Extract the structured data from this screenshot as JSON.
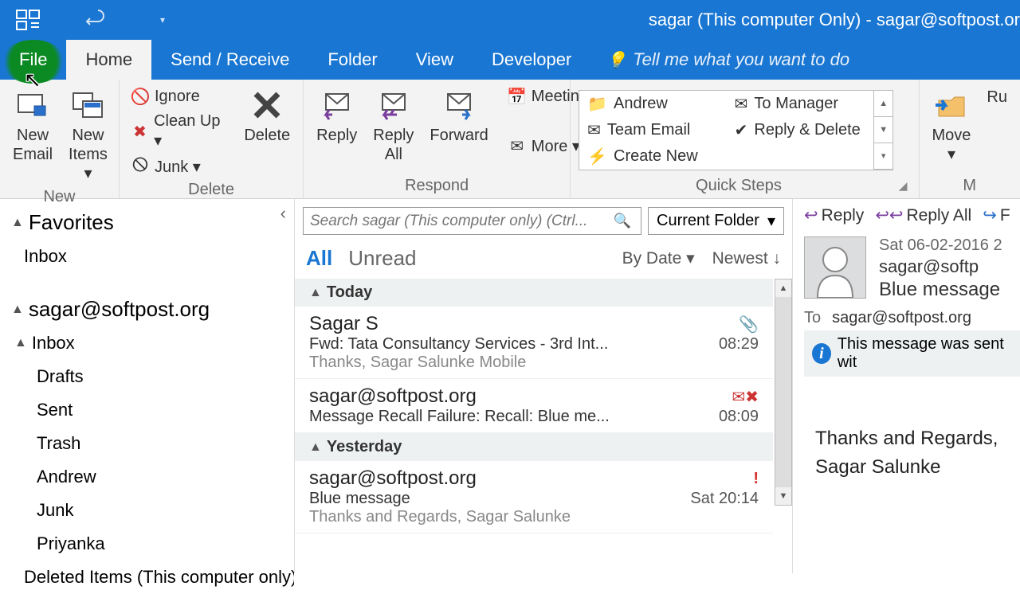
{
  "title": "sagar (This computer Only) - sagar@softpost.or",
  "tabs": {
    "file": "File",
    "home": "Home",
    "sendreceive": "Send / Receive",
    "folder": "Folder",
    "view": "View",
    "developer": "Developer",
    "tellme": "Tell me what you want to do"
  },
  "ribbon": {
    "new": {
      "label": "New",
      "newEmail": "New\nEmail",
      "newItems": "New\nItems ▾"
    },
    "delete": {
      "label": "Delete",
      "ignore": "Ignore",
      "cleanup": "Clean Up ▾",
      "junk": "Junk ▾",
      "delete": "Delete"
    },
    "respond": {
      "label": "Respond",
      "reply": "Reply",
      "replyAll": "Reply\nAll",
      "forward": "Forward",
      "meeting": "Meeting",
      "more": "More ▾"
    },
    "quicksteps": {
      "label": "Quick Steps",
      "items": [
        "Andrew",
        "To Manager",
        "Team Email",
        "Reply & Delete",
        "Create New"
      ]
    },
    "move": {
      "label": "M",
      "move": "Move\n▾",
      "rules": "Ru"
    }
  },
  "nav": {
    "favorites": "Favorites",
    "inbox": "Inbox",
    "account": "sagar@softpost.org",
    "folders": [
      "Inbox",
      "Drafts",
      "Sent",
      "Trash",
      "Andrew",
      "Junk",
      "Priyanka",
      "Deleted Items (This computer only)"
    ]
  },
  "search": {
    "placeholder": "Search sagar (This computer only) (Ctrl...",
    "scope": "Current Folder"
  },
  "filters": {
    "all": "All",
    "unread": "Unread",
    "sortBy": "By Date ▾",
    "order": "Newest ↓"
  },
  "groups": {
    "today": "Today",
    "yesterday": "Yesterday"
  },
  "messages": [
    {
      "sender": "Sagar S",
      "subject": "Fwd: Tata Consultancy Services - 3rd Int...",
      "preview": "Thanks,  Sagar Salunke  Mobile",
      "time": "08:29",
      "attach": true
    },
    {
      "sender": "sagar@softpost.org",
      "subject": "Message Recall Failure: Recall: Blue me...",
      "preview": "",
      "time": "08:09",
      "recall": true
    },
    {
      "sender": "sagar@softpost.org",
      "subject": "Blue message",
      "preview": "Thanks and Regards,  Sagar Salunke",
      "time": "Sat 20:14",
      "important": true
    }
  ],
  "reading": {
    "actions": {
      "reply": "Reply",
      "replyAll": "Reply All",
      "forward": "F"
    },
    "date": "Sat 06-02-2016 2",
    "from": "sagar@softp",
    "subject": "Blue message",
    "toLabel": "To",
    "to": "sagar@softpost.org",
    "info": "This message was sent wit",
    "body1": "Thanks and Regards,",
    "body2": "Sagar Salunke"
  }
}
